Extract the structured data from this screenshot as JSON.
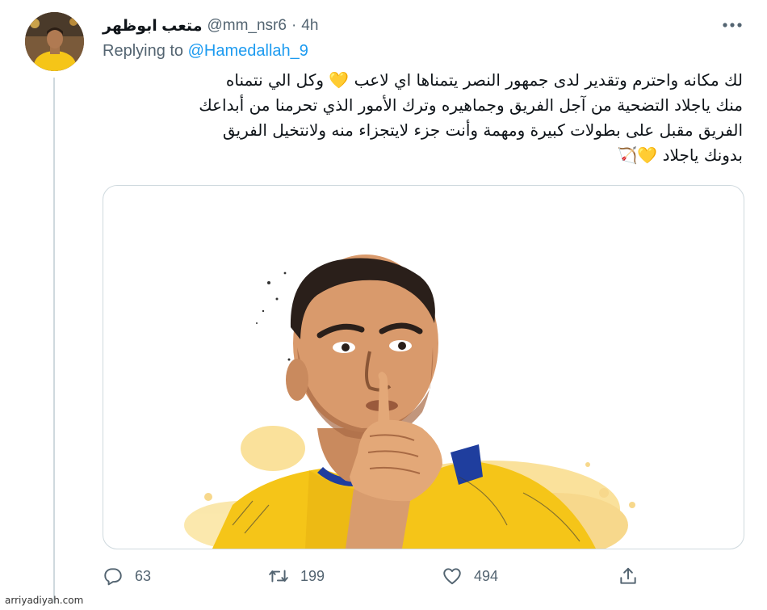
{
  "tweet": {
    "display_name": "متعب ابوظهر",
    "handle": "@mm_nsr6",
    "separator": "·",
    "time": "4h",
    "replying_prefix": "Replying to",
    "replying_handle": "@Hamedallah_9",
    "text_lines": [
      "لك مكانه واحترم وتقدير لدى جمهور النصر يتمناها اي لاعب",
      "وكل الي نتمناه",
      "منك ياجلاد التضحية من آجل الفريق وجماهيره وترك الأمور الذي تحرمنا من أبداعك",
      "الفريق مقبل على بطولات كبيرة ومهمة وأنت جزء لايتجزاء منه ولانتخيل الفريق",
      "بدونك ياجلاد"
    ],
    "emoji": {
      "heart": "💛",
      "bow": "🏹"
    }
  },
  "actions": {
    "reply_count": "63",
    "retweet_count": "199",
    "like_count": "494"
  },
  "icons": {
    "more": "more-dots-icon",
    "reply": "reply-icon",
    "retweet": "retweet-icon",
    "like": "heart-icon",
    "share": "share-icon"
  },
  "colors": {
    "link": "#1d9bf0",
    "secondary_text": "#536471",
    "jersey_yellow": "#f5c518",
    "jersey_blue": "#1f3e9e"
  },
  "watermark": "arriyadiyah.com"
}
